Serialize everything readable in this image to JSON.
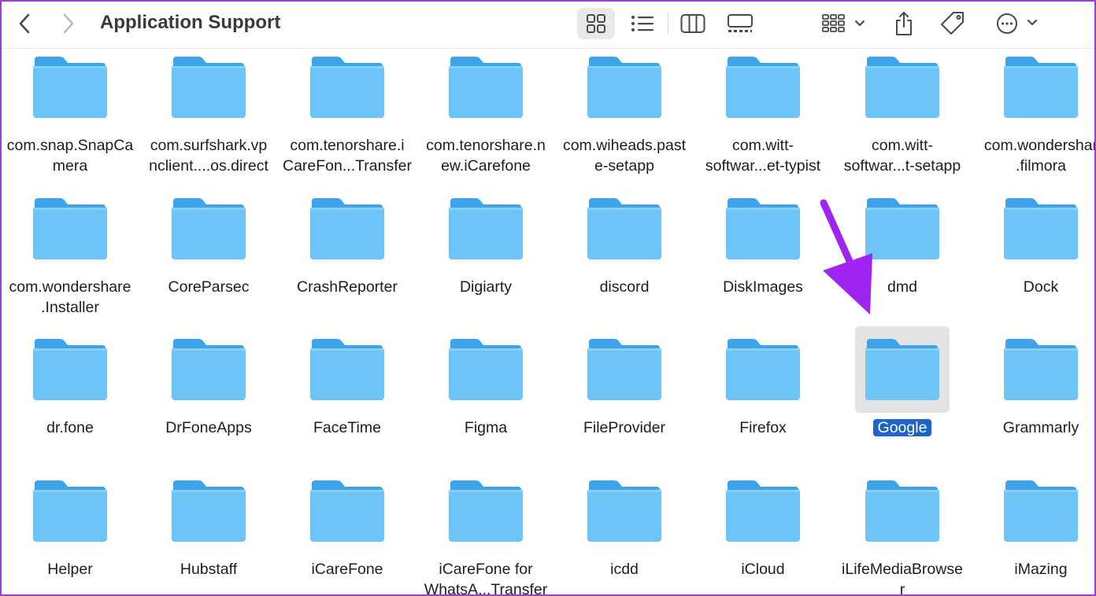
{
  "window": {
    "title": "Application Support"
  },
  "toolbar": {
    "back_icon": "chevron-left-icon",
    "forward_icon": "chevron-right-icon",
    "view_icons": [
      "icon-view-icon",
      "list-view-icon",
      "column-view-icon",
      "gallery-view-icon"
    ],
    "active_view": "icon-view-icon",
    "group_icon": "group-by-icon",
    "share_icon": "share-icon",
    "tag_icon": "tag-icon",
    "more_icon": "more-actions-icon"
  },
  "colors": {
    "folder_body": "#6cc4f7",
    "folder_tab": "#3ea3e8",
    "selection_bg": "#1e63c7",
    "arrow": "#a024f2"
  },
  "files": [
    {
      "label": "com.snap.SnapCa\nmera"
    },
    {
      "label": "com.surfshark.vp\nnclient....os.direct"
    },
    {
      "label": "com.tenorshare.i\nCareFon...Transfer"
    },
    {
      "label": "com.tenorshare.n\new.iCarefone"
    },
    {
      "label": "com.wiheads.past\ne-setapp"
    },
    {
      "label": "com.witt-\nsoftwar...et-typist"
    },
    {
      "label": "com.witt-\nsoftwar...t-setapp"
    },
    {
      "label": "com.wondershar\n.filmora"
    },
    {
      "label": "com.wondershare\n.Installer"
    },
    {
      "label": "CoreParsec"
    },
    {
      "label": "CrashReporter"
    },
    {
      "label": "Digiarty"
    },
    {
      "label": "discord"
    },
    {
      "label": "DiskImages"
    },
    {
      "label": "dmd"
    },
    {
      "label": "Dock"
    },
    {
      "label": "dr.fone"
    },
    {
      "label": "DrFoneApps"
    },
    {
      "label": "FaceTime"
    },
    {
      "label": "Figma"
    },
    {
      "label": "FileProvider"
    },
    {
      "label": "Firefox"
    },
    {
      "label": "Google",
      "selected": true
    },
    {
      "label": "Grammarly"
    },
    {
      "label": "Helper"
    },
    {
      "label": "Hubstaff"
    },
    {
      "label": "iCareFone"
    },
    {
      "label": "iCareFone for\nWhatsA...Transfer"
    },
    {
      "label": "icdd"
    },
    {
      "label": "iCloud"
    },
    {
      "label": "iLifeMediaBrowse\nr"
    },
    {
      "label": "iMazing"
    }
  ]
}
